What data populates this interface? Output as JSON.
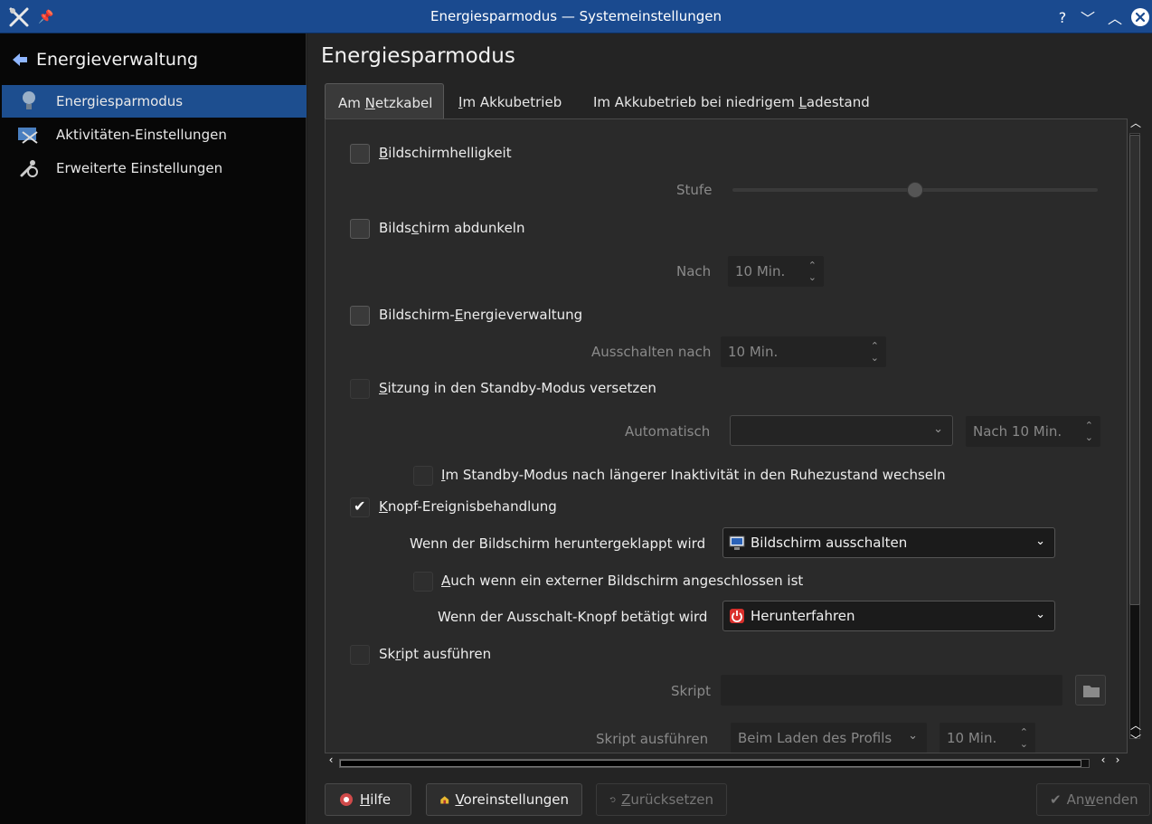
{
  "window": {
    "title": "Energiesparmodus — Systemeinstellungen",
    "controls": [
      "?",
      "﹀",
      "︿",
      "✕"
    ]
  },
  "sidebar": {
    "header": "Energieverwaltung",
    "items": [
      {
        "label": "Energiesparmodus",
        "icon": "lightbulb-icon",
        "active": true
      },
      {
        "label": "Aktivitäten-Einstellungen",
        "icon": "activities-icon",
        "active": false
      },
      {
        "label": "Erweiterte Einstellungen",
        "icon": "tools-icon",
        "active": false
      }
    ]
  },
  "main": {
    "title": "Energiesparmodus",
    "tabs": [
      {
        "pre": "Am ",
        "u": "N",
        "post": "etzkabel",
        "active": true
      },
      {
        "pre": "",
        "u": "I",
        "post": "m Akkubetrieb",
        "active": false
      },
      {
        "pre": "Im Akkubetrieb bei niedrigem ",
        "u": "L",
        "post": "adestand",
        "active": false
      }
    ]
  },
  "form": {
    "brightness": {
      "label_u": "B",
      "label": "ildschirmhelligkeit",
      "checked": false,
      "stufe_label": "Stufe",
      "level_fraction": 0.5
    },
    "dim": {
      "label_pre": "Bilds",
      "label_u": "c",
      "label_post": "hirm abdunkeln",
      "checked": false,
      "nach_label": "Nach",
      "value": "10 Min."
    },
    "dpms": {
      "label_pre": "Bildschirm-",
      "label_u": "E",
      "label_post": "nergieverwaltung",
      "checked": false,
      "off_label": "Ausschalten nach",
      "value": "10 Min."
    },
    "standby": {
      "label_u": "S",
      "label": "itzung in den Standby-Modus versetzen",
      "checked": false,
      "auto_label": "Automatisch",
      "combo_value": "",
      "after_value": "Nach 10 Min."
    },
    "hibernate": {
      "label_u": "I",
      "label": "m Standby-Modus nach längerer Inaktivität in den Ruhezustand wechseln",
      "checked": false
    },
    "buttons": {
      "label_pre": "",
      "label_u": "K",
      "label_post": "nopf-Ereignisbehandlung",
      "checked": true,
      "lid_label": "Wenn der Bildschirm heruntergeklappt wird",
      "lid_value": "Bildschirm ausschalten",
      "external_label_u": "A",
      "external_label": "uch wenn ein externer Bildschirm angeschlossen ist",
      "external_checked": false,
      "power_label": "Wenn der Ausschalt-Knopf betätigt wird",
      "power_value": "Herunterfahren"
    },
    "script": {
      "label_pre": "Sk",
      "label_u": "r",
      "label_post": "ipt ausführen",
      "checked": false,
      "script_label": "Skript",
      "script_value": "",
      "run_label": "Skript ausführen",
      "run_value": "Beim Laden des Profils",
      "run_delay": "10 Min."
    }
  },
  "bottom": {
    "help": {
      "u": "H",
      "rest": "ilfe"
    },
    "defaults": {
      "u": "V",
      "rest": "oreinstellungen"
    },
    "reset": {
      "u": "Z",
      "rest": "urücksetzen"
    },
    "apply": {
      "pre": "An",
      "u": "w",
      "rest": "enden"
    }
  }
}
